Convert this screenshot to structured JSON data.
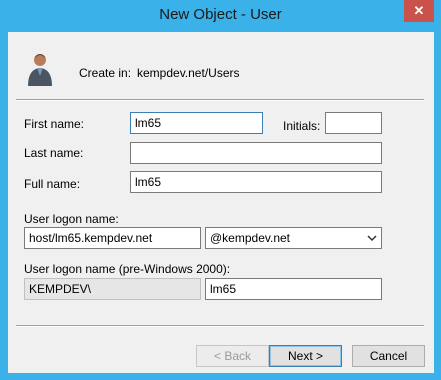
{
  "window": {
    "title": "New Object - User",
    "close_glyph": "✕"
  },
  "header": {
    "create_in_label": "Create in:",
    "create_in_path": "kempdev.net/Users",
    "icon": "user-icon"
  },
  "fields": {
    "first_name_label": "First name:",
    "first_name_value": "lm65",
    "initials_label": "Initials:",
    "initials_value": "",
    "last_name_label": "Last name:",
    "last_name_value": "",
    "full_name_label": "Full name:",
    "full_name_value": "lm65",
    "logon_name_label": "User logon name:",
    "logon_name_value": "host/lm65.kempdev.net",
    "domain_suffix_value": "@kempdev.net",
    "pre2000_label": "User logon name (pre-Windows 2000):",
    "pre2000_domain_value": "KEMPDEV\\",
    "pre2000_name_value": "lm65"
  },
  "buttons": {
    "back": "< Back",
    "next": "Next >",
    "cancel": "Cancel"
  },
  "colors": {
    "titlebar": "#3ab1e8",
    "close": "#c9524a",
    "dialog_bg": "#f0f0f0"
  }
}
